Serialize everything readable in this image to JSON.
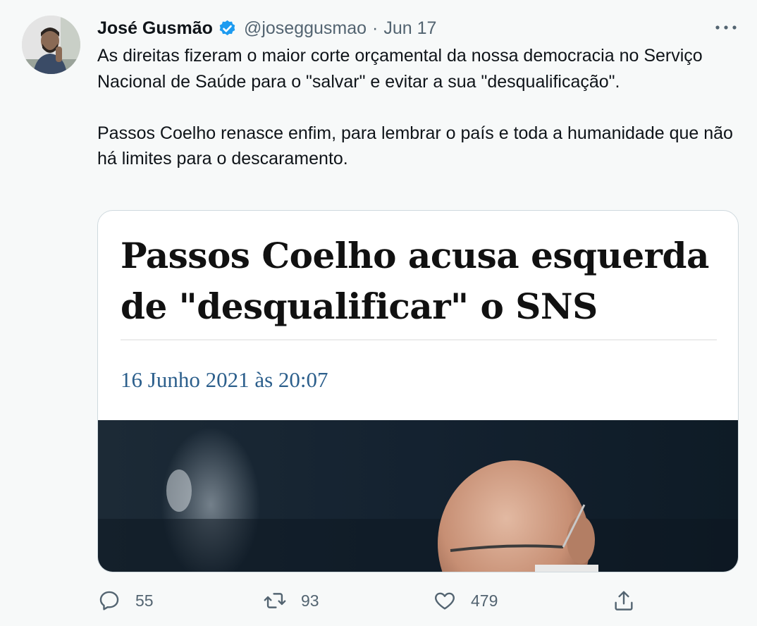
{
  "tweet": {
    "author_name": "José Gusmão",
    "handle": "@joseggusmao",
    "separator": "·",
    "date": "Jun 17",
    "paragraphs": [
      "As direitas fizeram o maior corte orçamental da nossa democracia no Serviço Nacional de Saúde para o \"salvar\" e evitar a sua \"desqualificação\".",
      "Passos Coelho renasce enfim, para lembrar o país e toda a humanidade que não há limites para o descaramento."
    ]
  },
  "card": {
    "headline": "Passos Coelho acusa esquerda de \"desqualificar\" o SNS",
    "published": "16 Junho 2021 às 20:07"
  },
  "actions": {
    "replies": "55",
    "retweets": "93",
    "likes": "479"
  },
  "colors": {
    "background": "#f7f9f9",
    "verified_blue": "#1d9bf0",
    "secondary_text": "#536471",
    "date_blue": "#2c5f8c"
  },
  "icons": [
    "more-icon",
    "verified-badge-icon",
    "reply-icon",
    "retweet-icon",
    "like-icon",
    "share-icon"
  ]
}
